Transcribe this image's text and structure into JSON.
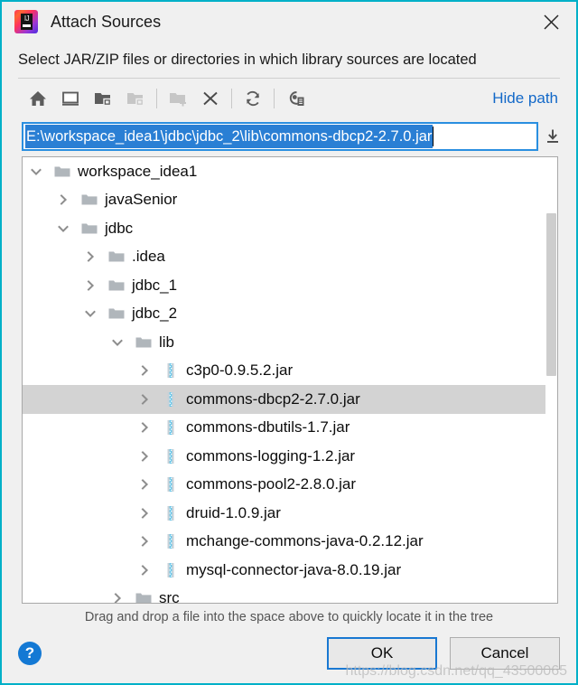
{
  "window": {
    "title": "Attach Sources",
    "app_icon": "intellij-idea-logo",
    "close_label": "✕",
    "border_color": "#00b0c8"
  },
  "prompt": {
    "text": "Select JAR/ZIP files or directories in which library sources are located"
  },
  "toolbar": {
    "buttons": [
      {
        "name": "home-icon",
        "title": "Home",
        "enabled": true
      },
      {
        "name": "desktop-icon",
        "title": "Desktop",
        "enabled": true
      },
      {
        "name": "project-folder-icon",
        "title": "Project Directory",
        "enabled": true
      },
      {
        "name": "module-folder-icon",
        "title": "Module Directory",
        "enabled": false
      },
      {
        "name": "new-folder-icon",
        "title": "New Folder",
        "enabled": false
      },
      {
        "name": "delete-icon",
        "title": "Delete",
        "enabled": true
      },
      {
        "name": "refresh-icon",
        "title": "Refresh",
        "enabled": true
      },
      {
        "name": "show-hidden-files-icon",
        "title": "Show Hidden Files and Directories",
        "enabled": true
      }
    ],
    "hide_path_label": "Hide path"
  },
  "path_field": {
    "value": "E:\\workspace_idea1\\jdbc\\jdbc_2\\lib\\commons-dbcp2-2.7.0.jar",
    "placeholder": "",
    "selected": true,
    "dropdown_icon": "download-arrow-icon"
  },
  "tree": {
    "rows": [
      {
        "label": "workspace_idea1",
        "icon": "folder-icon",
        "indent": 1,
        "twisty": "expanded",
        "selected": false
      },
      {
        "label": "javaSenior",
        "icon": "folder-icon",
        "indent": 2,
        "twisty": "collapsed",
        "selected": false
      },
      {
        "label": "jdbc",
        "icon": "folder-icon",
        "indent": 2,
        "twisty": "expanded",
        "selected": false
      },
      {
        "label": ".idea",
        "icon": "folder-icon",
        "indent": 3,
        "twisty": "collapsed",
        "selected": false
      },
      {
        "label": "jdbc_1",
        "icon": "folder-icon",
        "indent": 3,
        "twisty": "collapsed",
        "selected": false
      },
      {
        "label": "jdbc_2",
        "icon": "folder-icon",
        "indent": 3,
        "twisty": "expanded",
        "selected": false
      },
      {
        "label": "lib",
        "icon": "folder-icon",
        "indent": 4,
        "twisty": "expanded",
        "selected": false
      },
      {
        "label": "c3p0-0.9.5.2.jar",
        "icon": "jar-archive-icon",
        "indent": 5,
        "twisty": "collapsed",
        "selected": false
      },
      {
        "label": "commons-dbcp2-2.7.0.jar",
        "icon": "jar-archive-icon",
        "indent": 5,
        "twisty": "collapsed",
        "selected": true
      },
      {
        "label": "commons-dbutils-1.7.jar",
        "icon": "jar-archive-icon",
        "indent": 5,
        "twisty": "collapsed",
        "selected": false
      },
      {
        "label": "commons-logging-1.2.jar",
        "icon": "jar-archive-icon",
        "indent": 5,
        "twisty": "collapsed",
        "selected": false
      },
      {
        "label": "commons-pool2-2.8.0.jar",
        "icon": "jar-archive-icon",
        "indent": 5,
        "twisty": "collapsed",
        "selected": false
      },
      {
        "label": "druid-1.0.9.jar",
        "icon": "jar-archive-icon",
        "indent": 5,
        "twisty": "collapsed",
        "selected": false
      },
      {
        "label": "mchange-commons-java-0.2.12.jar",
        "icon": "jar-archive-icon",
        "indent": 5,
        "twisty": "collapsed",
        "selected": false
      },
      {
        "label": "mysql-connector-java-8.0.19.jar",
        "icon": "jar-archive-icon",
        "indent": 5,
        "twisty": "collapsed",
        "selected": false
      },
      {
        "label": "src",
        "icon": "folder-icon",
        "indent": 4,
        "twisty": "collapsed",
        "selected": false
      }
    ]
  },
  "hint": {
    "text": "Drag and drop a file into the space above to quickly locate it in the tree"
  },
  "footer": {
    "help_label": "?",
    "ok_label": "OK",
    "cancel_label": "Cancel",
    "watermark": "https://blog.csdn.net/qq_43500065"
  },
  "colors": {
    "accent": "#1978d2",
    "selection": "#2a7fd4",
    "row_selected": "#d3d3d3",
    "link": "#1268c8",
    "border": "#00b0c8"
  }
}
